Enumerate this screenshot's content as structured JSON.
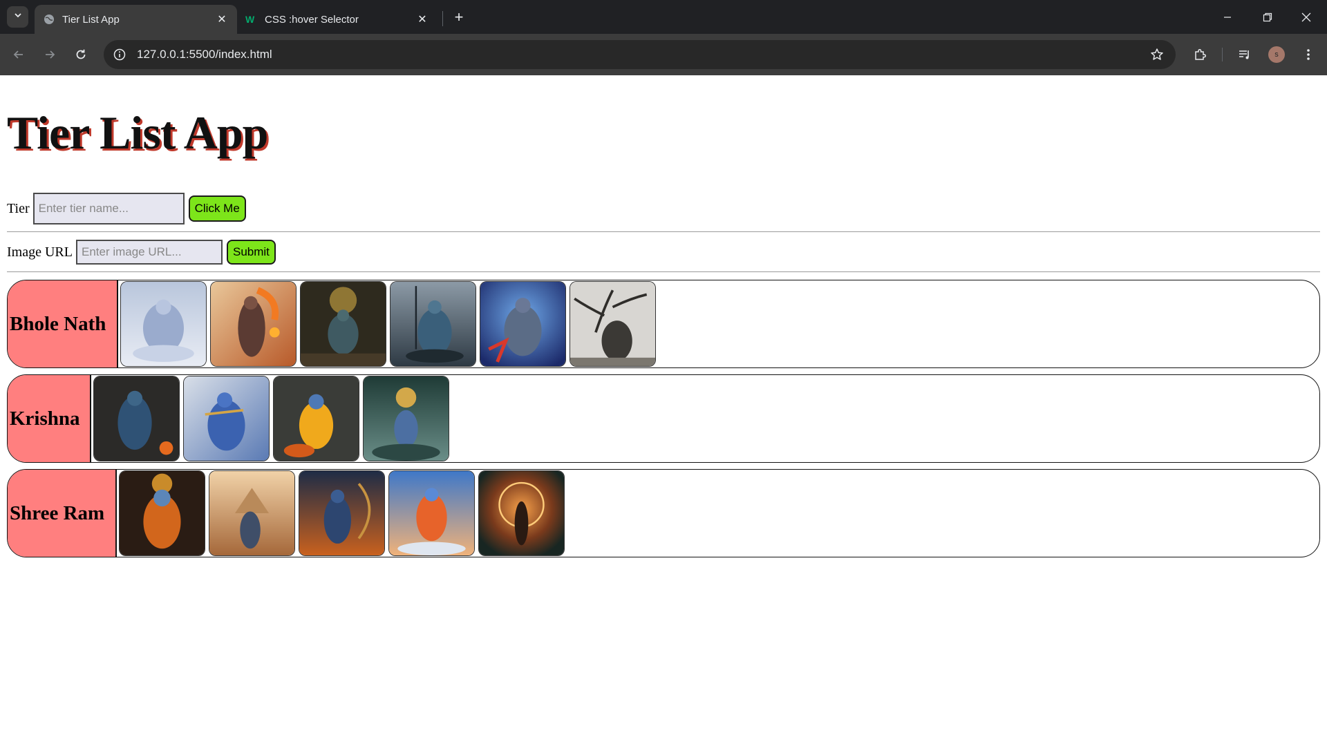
{
  "browser": {
    "tabs": [
      {
        "title": "Tier List App",
        "active": true,
        "favicon": "globe-icon"
      },
      {
        "title": "CSS :hover Selector",
        "active": false,
        "favicon": "w3schools-icon"
      }
    ],
    "url": "127.0.0.1:5500/index.html",
    "profile_initial": "s"
  },
  "page": {
    "title": "Tier List App",
    "tier_form": {
      "label": "Tier",
      "placeholder": "Enter tier name...",
      "button": "Click Me"
    },
    "image_form": {
      "label": "Image URL",
      "placeholder": "Enter image URL...",
      "button": "Submit"
    },
    "tiers": [
      {
        "name": "Bhole Nath",
        "image_count": 6
      },
      {
        "name": "Krishna",
        "image_count": 4
      },
      {
        "name": "Shree Ram",
        "image_count": 5
      }
    ]
  },
  "colors": {
    "tier_label_bg": "#ff7f7f",
    "button_bg": "#7de51a",
    "title_shadow": "#c0392b"
  }
}
